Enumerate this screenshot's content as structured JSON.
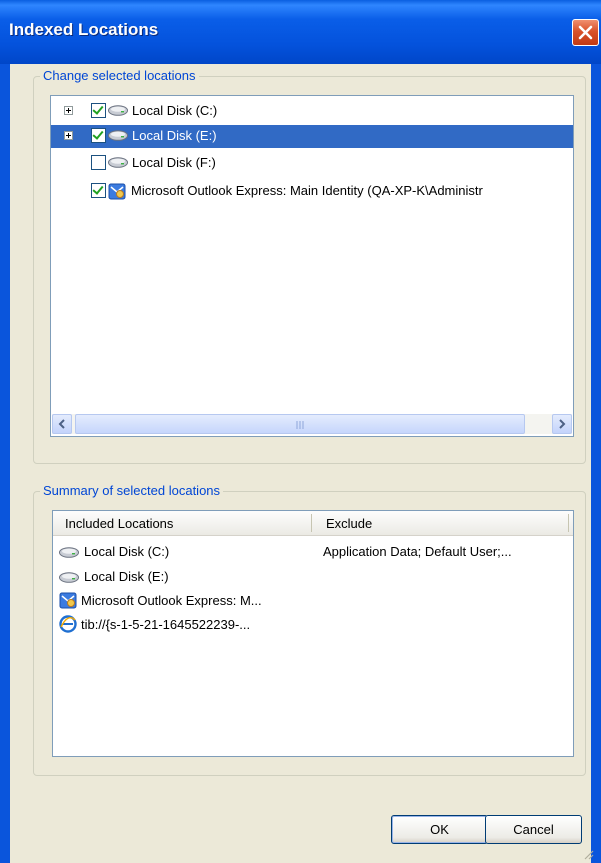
{
  "window": {
    "title": "Indexed Locations"
  },
  "change_group": {
    "legend": "Change selected locations",
    "items": [
      {
        "label": "Local Disk (C:)",
        "checked": true,
        "expandable": true,
        "selected": false,
        "icon": "drive-icon"
      },
      {
        "label": "Local Disk (E:)",
        "checked": true,
        "expandable": true,
        "selected": true,
        "icon": "drive-icon"
      },
      {
        "label": "Local Disk (F:)",
        "checked": false,
        "expandable": false,
        "selected": false,
        "icon": "drive-icon"
      },
      {
        "label": "Microsoft Outlook Express: Main Identity (QA-XP-K\\Administr",
        "checked": true,
        "expandable": false,
        "selected": false,
        "icon": "outlook-express-icon"
      }
    ]
  },
  "summary_group": {
    "legend": "Summary of selected locations",
    "columns": [
      "Included Locations",
      "Exclude"
    ],
    "rows": [
      {
        "included": "Local Disk (C:)",
        "exclude": "Application Data; Default User;...",
        "icon": "drive-icon"
      },
      {
        "included": "Local Disk (E:)",
        "exclude": "",
        "icon": "drive-icon"
      },
      {
        "included": "Microsoft Outlook Express: M...",
        "exclude": "",
        "icon": "outlook-express-icon"
      },
      {
        "included": "tib://{s-1-5-21-1645522239-...",
        "exclude": "",
        "icon": "ie-icon"
      }
    ]
  },
  "buttons": {
    "ok": "OK",
    "cancel": "Cancel"
  },
  "colors": {
    "title_bar": "#0055e5",
    "selection": "#316ac5",
    "legend_text": "#0046d5",
    "dialog_bg": "#ece9d8"
  }
}
